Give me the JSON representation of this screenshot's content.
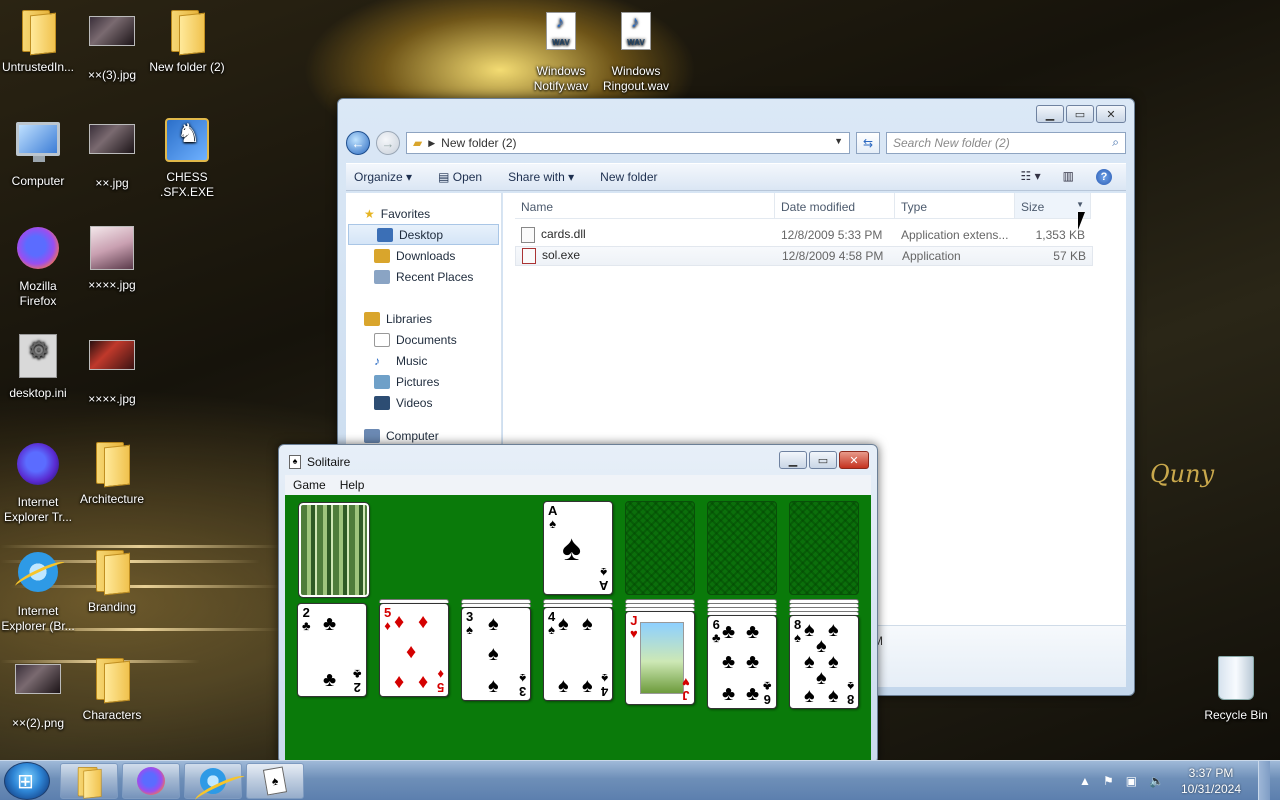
{
  "desktop": {
    "icons": [
      {
        "label": "UntrustedIn...",
        "icon": "folder-user-icon"
      },
      {
        "label": "××(3).jpg",
        "icon": "image-icon"
      },
      {
        "label": "New folder (2)",
        "icon": "folder-icon"
      },
      {
        "label": "Windows Notify.wav",
        "icon": "wav-icon"
      },
      {
        "label": "Windows Ringout.wav",
        "icon": "wav-icon"
      },
      {
        "label": "Computer",
        "icon": "computer-icon"
      },
      {
        "label": "××.jpg",
        "icon": "image-icon"
      },
      {
        "label": "CHESS .SFX.EXE",
        "icon": "setup-icon"
      },
      {
        "label": "Mozilla Firefox",
        "icon": "firefox-icon"
      },
      {
        "label": "××××.jpg",
        "icon": "image-icon"
      },
      {
        "label": "desktop.ini",
        "icon": "settings-file-icon"
      },
      {
        "label": "××××.jpg",
        "icon": "image-icon"
      },
      {
        "label": "Internet Explorer Tr...",
        "icon": "ie-icon"
      },
      {
        "label": "Architecture",
        "icon": "folder-icon"
      },
      {
        "label": "Internet Explorer (Br...",
        "icon": "ie-icon"
      },
      {
        "label": "Branding",
        "icon": "folder-icon"
      },
      {
        "label": "××(2).png",
        "icon": "image-icon"
      },
      {
        "label": "Characters",
        "icon": "folder-icon"
      },
      {
        "label": "Recycle Bin",
        "icon": "recycle-bin-icon"
      }
    ],
    "wallpaper_text": "Quny"
  },
  "explorer": {
    "address": "New folder (2)",
    "search_placeholder": "Search New folder (2)",
    "toolbar": {
      "organize": "Organize",
      "open": "Open",
      "share": "Share with",
      "new_folder": "New folder"
    },
    "nav": {
      "favorites": "Favorites",
      "desktop": "Desktop",
      "downloads": "Downloads",
      "recent": "Recent Places",
      "libraries": "Libraries",
      "documents": "Documents",
      "music": "Music",
      "pictures": "Pictures",
      "videos": "Videos",
      "computer": "Computer"
    },
    "columns": {
      "name": "Name",
      "date": "Date modified",
      "type": "Type",
      "size": "Size"
    },
    "files": [
      {
        "name": "cards.dll",
        "date": "12/8/2009 5:33 PM",
        "type": "Application extens...",
        "size": "1,353 KB"
      },
      {
        "name": "sol.exe",
        "date": "12/8/2009 4:58 PM",
        "type": "Application",
        "size": "57 KB"
      }
    ],
    "details_fragment": "M"
  },
  "solitaire": {
    "title": "Solitaire",
    "menu": {
      "game": "Game",
      "help": "Help"
    },
    "foundation_card": {
      "rank": "A",
      "suit": "♠"
    },
    "tableau": [
      {
        "rank": "2",
        "suit": "♣",
        "color": "blk"
      },
      {
        "rank": "5",
        "suit": "♦",
        "color": "red"
      },
      {
        "rank": "3",
        "suit": "♠",
        "color": "blk"
      },
      {
        "rank": "4",
        "suit": "♠",
        "color": "blk"
      },
      {
        "rank": "J",
        "suit": "♥",
        "color": "red"
      },
      {
        "rank": "6",
        "suit": "♣",
        "color": "blk"
      },
      {
        "rank": "8",
        "suit": "♠",
        "color": "blk"
      }
    ]
  },
  "taskbar": {
    "clock_time": "3:37 PM",
    "clock_date": "10/31/2024",
    "pinned": [
      "explorer-icon",
      "firefox-icon",
      "ie-icon",
      "solitaire-icon"
    ]
  },
  "colors": {
    "felt": "#0a7a0a",
    "taskbar": "#6e8fb8",
    "accent": "#2c6bc2"
  }
}
